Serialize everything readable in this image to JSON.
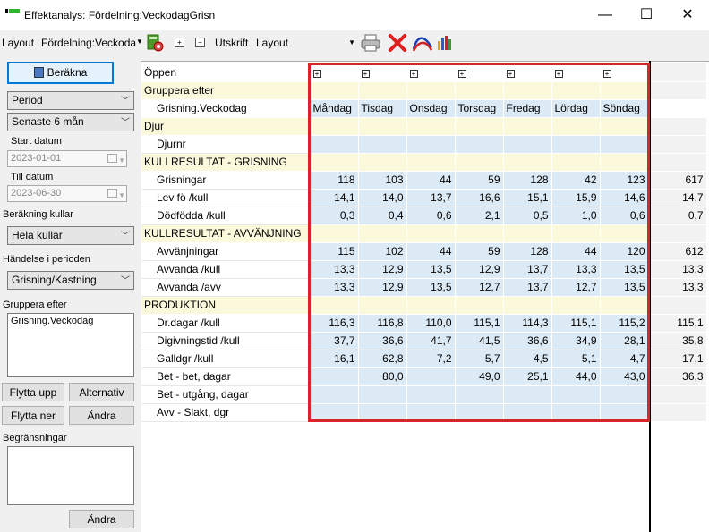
{
  "window": {
    "title": "Effektanalys: Fördelning:VeckodagGrisn",
    "minimize": "—",
    "maximize": "☐",
    "close": "✕"
  },
  "toolbar": {
    "layout_label": "Layout",
    "layout_dropdown": "Fördelning:Veckoda",
    "expand_all": "+",
    "collapse_all": "−",
    "print_label": "Utskrift",
    "print_layout": "Layout",
    "icons": [
      "calculator-settings-icon",
      "printer-icon",
      "delete-x-icon",
      "chart-curve-icon",
      "bar-chart-icon"
    ]
  },
  "left_panel": {
    "calculate_button": "Beräkna",
    "period_combo": "Period",
    "range_combo": "Senaste 6 mån",
    "start_label": "Start datum",
    "start_value": "2023-01-01",
    "end_label": "Till datum",
    "end_value": "2023-06-30",
    "calc_litters_label": "Beräkning kullar",
    "calc_litters_combo": "Hela kullar",
    "event_label": "Händelse i perioden",
    "event_combo": "Grisning/Kastning",
    "group_by_label": "Gruppera efter",
    "group_by_items": [
      "Grisning.Veckodag"
    ],
    "move_up": "Flytta upp",
    "alternatives": "Alternativ",
    "move_down": "Flytta ner",
    "change": "Ändra",
    "restrictions_label": "Begränsningar",
    "change2": "Ändra"
  },
  "grid": {
    "open_label": "Öppen",
    "days": [
      "Måndag",
      "Tisdag",
      "Onsdag",
      "Torsdag",
      "Fredag",
      "Lördag",
      "Söndag"
    ],
    "rows": [
      {
        "label": "Gruppera efter",
        "type": "section",
        "cells": [
          "",
          "",
          "",
          "",
          "",
          "",
          ""
        ],
        "total": ""
      },
      {
        "label": "Grisning.Veckodag",
        "type": "hdr",
        "cells": [
          "Måndag",
          "Tisdag",
          "Onsdag",
          "Torsdag",
          "Fredag",
          "Lördag",
          "Söndag"
        ],
        "total": ""
      },
      {
        "label": "Djur",
        "type": "section",
        "cells": [
          "",
          "",
          "",
          "",
          "",
          "",
          ""
        ],
        "total": ""
      },
      {
        "label": "Djurnr",
        "type": "drow",
        "cells": [
          "",
          "",
          "",
          "",
          "",
          "",
          ""
        ],
        "total": ""
      },
      {
        "label": "KULLRESULTAT - GRISNING",
        "type": "section",
        "cells": [
          "",
          "",
          "",
          "",
          "",
          "",
          ""
        ],
        "total": ""
      },
      {
        "label": "Grisningar",
        "type": "drow",
        "cells": [
          "118",
          "103",
          "44",
          "59",
          "128",
          "42",
          "123"
        ],
        "total": "617"
      },
      {
        "label": "Lev fö /kull",
        "type": "drow",
        "cells": [
          "14,1",
          "14,0",
          "13,7",
          "16,6",
          "15,1",
          "15,9",
          "14,6"
        ],
        "total": "14,7"
      },
      {
        "label": "Dödfödda /kull",
        "type": "drow",
        "cells": [
          "0,3",
          "0,4",
          "0,6",
          "2,1",
          "0,5",
          "1,0",
          "0,6"
        ],
        "total": "0,7"
      },
      {
        "label": "KULLRESULTAT - AVVÄNJNING",
        "type": "section",
        "cells": [
          "",
          "",
          "",
          "",
          "",
          "",
          ""
        ],
        "total": ""
      },
      {
        "label": "Avvänjningar",
        "type": "drow",
        "cells": [
          "115",
          "102",
          "44",
          "59",
          "128",
          "44",
          "120"
        ],
        "total": "612"
      },
      {
        "label": "Avvanda /kull",
        "type": "drow",
        "cells": [
          "13,3",
          "12,9",
          "13,5",
          "12,9",
          "13,7",
          "13,3",
          "13,5"
        ],
        "total": "13,3"
      },
      {
        "label": "Avvanda /avv",
        "type": "drow",
        "cells": [
          "13,3",
          "12,9",
          "13,5",
          "12,7",
          "13,7",
          "12,7",
          "13,5"
        ],
        "total": "13,3"
      },
      {
        "label": "PRODUKTION",
        "type": "section",
        "cells": [
          "",
          "",
          "",
          "",
          "",
          "",
          ""
        ],
        "total": ""
      },
      {
        "label": "Dr.dagar /kull",
        "type": "drow",
        "cells": [
          "116,3",
          "116,8",
          "110,0",
          "115,1",
          "114,3",
          "115,1",
          "115,2"
        ],
        "total": "115,1"
      },
      {
        "label": "Digivningstid /kull",
        "type": "drow",
        "cells": [
          "37,7",
          "36,6",
          "41,7",
          "41,5",
          "36,6",
          "34,9",
          "28,1"
        ],
        "total": "35,8"
      },
      {
        "label": "Galldgr /kull",
        "type": "drow",
        "cells": [
          "16,1",
          "62,8",
          "7,2",
          "5,7",
          "4,5",
          "5,1",
          "4,7"
        ],
        "total": "17,1"
      },
      {
        "label": "Bet - bet, dagar",
        "type": "drow",
        "cells": [
          "",
          "80,0",
          "",
          "49,0",
          "25,1",
          "44,0",
          "43,0"
        ],
        "total": "36,3"
      },
      {
        "label": "Bet - utgång, dagar",
        "type": "drow",
        "cells": [
          "",
          "",
          "",
          "",
          "",
          "",
          ""
        ],
        "total": ""
      },
      {
        "label": "Avv - Slakt, dgr",
        "type": "drow",
        "cells": [
          "",
          "",
          "",
          "",
          "",
          "",
          ""
        ],
        "total": ""
      }
    ]
  },
  "colors": {
    "section_bg": "#fcf8dc",
    "data_bg": "#dceaf5",
    "highlight": "#d7262b"
  }
}
